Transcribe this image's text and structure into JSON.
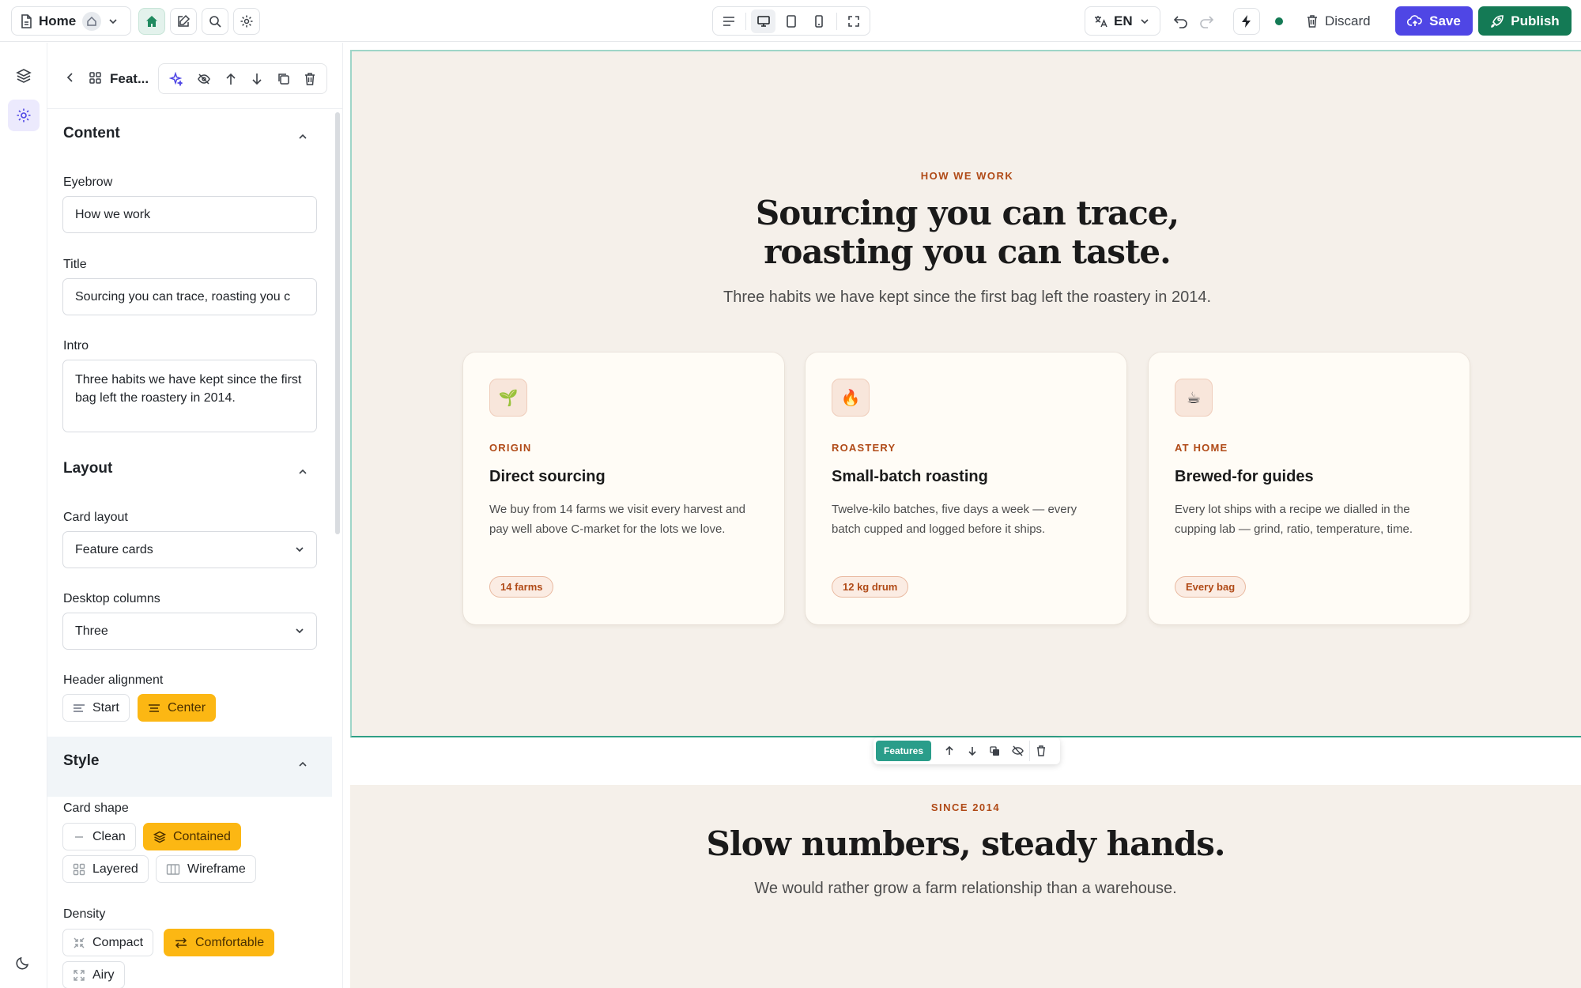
{
  "topbar": {
    "page_label": "Home",
    "lang_code": "EN",
    "discard_label": "Discard",
    "save_label": "Save",
    "publish_label": "Publish",
    "status_color": "#147a55"
  },
  "panel": {
    "block_title": "Feat...",
    "sections": {
      "content": "Content",
      "layout": "Layout",
      "style": "Style"
    },
    "fields": {
      "eyebrow_label": "Eyebrow",
      "eyebrow_value": "How we work",
      "title_label": "Title",
      "title_value": "Sourcing you can trace, roasting you c",
      "intro_label": "Intro",
      "intro_value": "Three habits we have kept since the first bag left the roastery in 2014.",
      "card_layout_label": "Card layout",
      "card_layout_value": "Feature cards",
      "desktop_columns_label": "Desktop columns",
      "desktop_columns_value": "Three",
      "header_alignment_label": "Header alignment",
      "card_shape_label": "Card shape",
      "density_label": "Density"
    },
    "header_alignment": [
      "Start",
      "Center"
    ],
    "card_shape": [
      "Clean",
      "Contained",
      "Layered",
      "Wireframe"
    ],
    "density": [
      "Compact",
      "Comfortable",
      "Airy"
    ]
  },
  "canvas": {
    "section1": {
      "eyebrow": "HOW WE WORK",
      "title_line1": "Sourcing you can trace,",
      "title_line2": "roasting you can taste.",
      "intro": "Three habits we have kept since the first bag left the roastery in 2014.",
      "cards": [
        {
          "icon": "🌱",
          "kicker": "ORIGIN",
          "title": "Direct sourcing",
          "desc": "We buy from 14 farms we visit every harvest and pay well above C-market for the lots we love.",
          "pill": "14 farms"
        },
        {
          "icon": "🔥",
          "kicker": "ROASTERY",
          "title": "Small-batch roasting",
          "desc": "Twelve-kilo batches, five days a week — every batch cupped and logged before it ships.",
          "pill": "12 kg drum"
        },
        {
          "icon": "☕",
          "kicker": "AT HOME",
          "title": "Brewed-for guides",
          "desc": "Every lot ships with a recipe we dialled in the cupping lab — grind, ratio, temperature, time.",
          "pill": "Every bag"
        }
      ]
    },
    "block_tag": "Features",
    "section2": {
      "eyebrow": "SINCE 2014",
      "title": "Slow numbers, steady hands.",
      "intro": "We would rather grow a farm relationship than a warehouse."
    }
  },
  "colors": {
    "accent_indigo": "#4f46e5",
    "accent_green": "#147a55",
    "chip_active": "#fcb713",
    "brand_rust": "#b04a17",
    "canvas_bg": "#f5f0ea",
    "block_teal": "#2a9d8a"
  }
}
